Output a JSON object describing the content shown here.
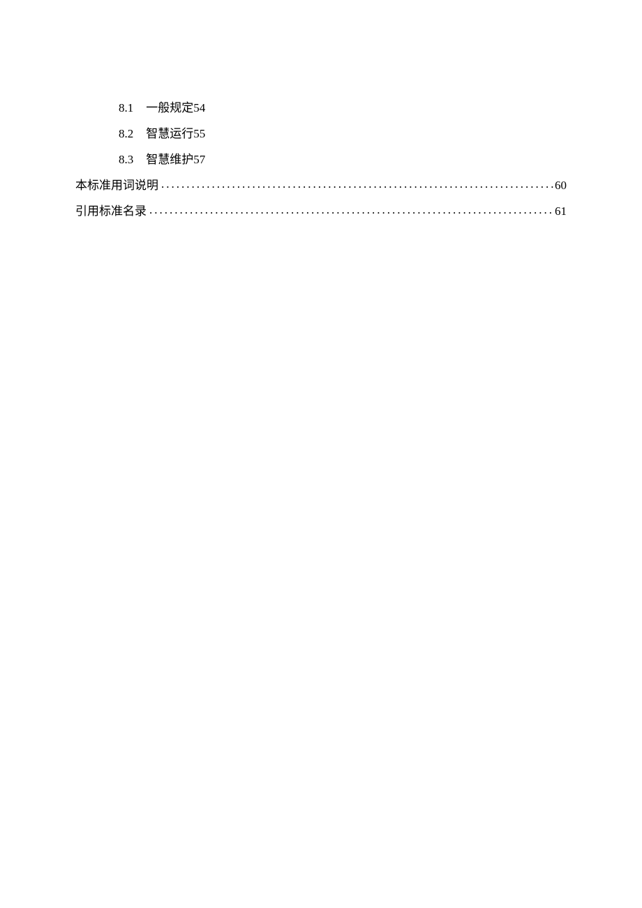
{
  "toc": {
    "subEntries": [
      {
        "num": "8.1",
        "title": "一般规定",
        "page": "54"
      },
      {
        "num": "8.2",
        "title": "智慧运行",
        "page": "55"
      },
      {
        "num": "8.3",
        "title": "智慧维护",
        "page": "57"
      }
    ],
    "mainEntries": [
      {
        "title": "本标准用词说明",
        "page": "60"
      },
      {
        "title": "引用标准名录",
        "page": "61"
      }
    ]
  },
  "leaderDots": "........................................................................................................"
}
